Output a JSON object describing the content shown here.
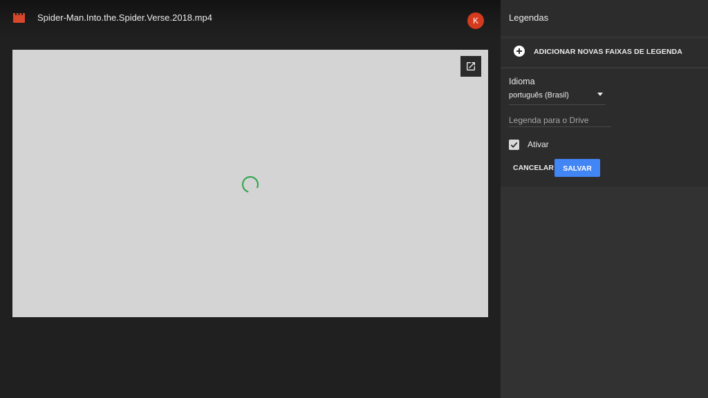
{
  "header": {
    "file_title": "Spider-Man.Into.the.Spider.Verse.2018.mp4",
    "file_icon": "video-file-icon",
    "avatar_initial": "K"
  },
  "preview": {
    "popout_icon": "open-in-new-icon",
    "loading_icon": "loading-spinner-icon"
  },
  "panel": {
    "title": "Legendas",
    "add_tracks_label": "ADICIONAR NOVAS FAIXAS DE LEGENDA",
    "add_icon": "add-circle-icon",
    "language_label": "Idioma",
    "language_value": "português (Brasil)",
    "name_placeholder": "Legenda para o Drive",
    "name_value": "",
    "enable_label": "Ativar",
    "enable_checked": true,
    "cancel_label": "CANCELAR",
    "save_label": "SALVAR"
  },
  "colors": {
    "background": "#202020",
    "panel": "#323232",
    "avatar": "#d43a1e",
    "accent_blue": "#4285f4",
    "spinner_green": "#34a853",
    "file_icon_red": "#d9472b"
  }
}
